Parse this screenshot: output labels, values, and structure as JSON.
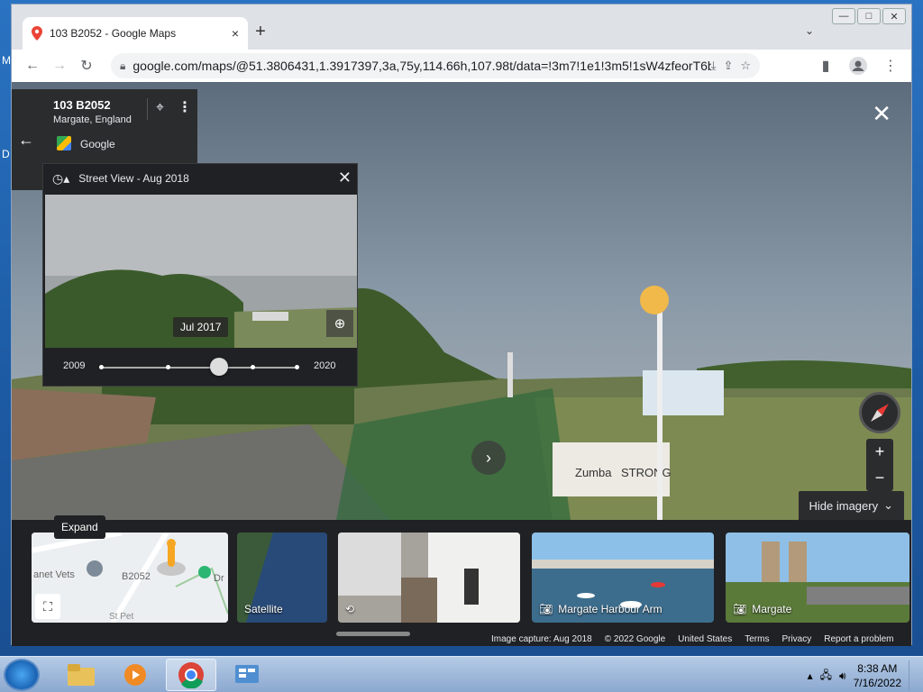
{
  "desktop": {
    "labels": [
      "M",
      "D"
    ]
  },
  "browser": {
    "tab_title": "103 B2052 - Google Maps",
    "url": "google.com/maps/@51.3806431,1.3917397,3a,75y,114.66h,107.98t/data=!3m7!1e1!3m5!1sW4zfeorT6b...",
    "tab_close": "×",
    "new_tab": "+",
    "tab_dropdown": "⌄"
  },
  "place": {
    "name": "103 B2052",
    "location": "Margate, England",
    "source": "Google"
  },
  "time_machine": {
    "title": "Street View - Aug 2018",
    "preview_date": "Jul 2017",
    "start_year": "2009",
    "end_year": "2020",
    "selected_position": 0.6
  },
  "controls": {
    "hide_imagery": "Hide imagery",
    "zoom_in": "+",
    "zoom_out": "−"
  },
  "thumbnails": [
    {
      "label": "",
      "type": "map",
      "map_texts": [
        "anet Vets",
        "B2052",
        "Dr",
        "St Pet"
      ]
    },
    {
      "label": "Satellite",
      "type": "satellite"
    },
    {
      "label": "",
      "type": "streetview"
    },
    {
      "label": "Margate Harbour Arm",
      "type": "photo"
    },
    {
      "label": "Margate",
      "type": "photo"
    }
  ],
  "tooltip": {
    "expand": "Expand"
  },
  "footer": {
    "capture": "Image capture: Aug 2018",
    "copyright": "© 2022 Google",
    "country": "United States",
    "terms": "Terms",
    "privacy": "Privacy",
    "report": "Report a problem"
  },
  "scene_signs": {
    "sign1": "Zumba",
    "sign2": "STRONG"
  },
  "taskbar": {
    "time": "8:38 AM",
    "date": "7/16/2022"
  }
}
